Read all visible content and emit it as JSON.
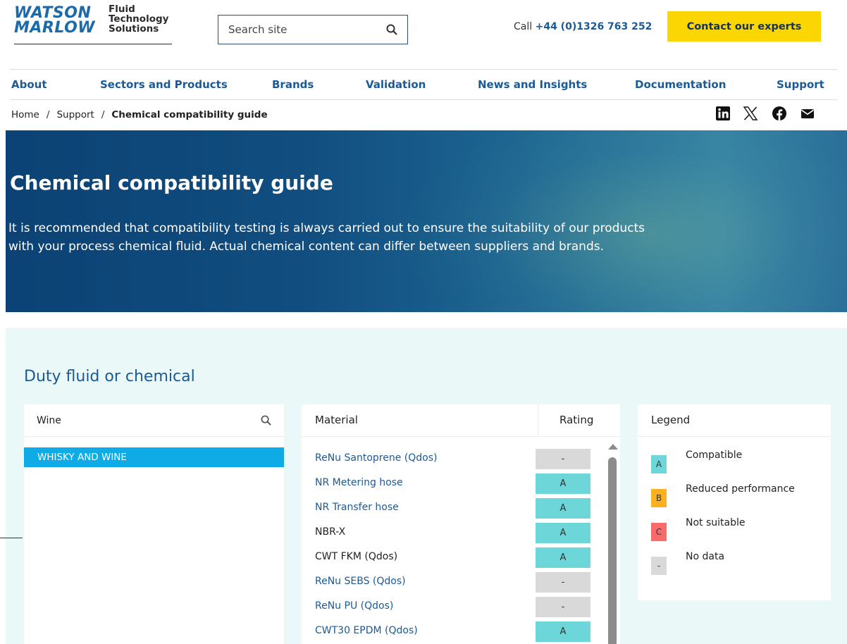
{
  "header": {
    "logo": {
      "line1": "WATSON",
      "line2": "MARLOW",
      "tagline": [
        "Fluid",
        "Technology",
        "Solutions"
      ]
    },
    "search": {
      "placeholder": "Search site",
      "icon": "search-icon"
    },
    "call": {
      "prefix": "Call",
      "number": "+44 (0)1326 763 252"
    },
    "cta_label": "Contact our experts"
  },
  "nav": {
    "items": [
      {
        "label": "About"
      },
      {
        "label": "Sectors and Products"
      },
      {
        "label": "Brands"
      },
      {
        "label": "Validation"
      },
      {
        "label": "News and Insights"
      },
      {
        "label": "Documentation"
      },
      {
        "label": "Support"
      }
    ]
  },
  "breadcrumb": {
    "items": [
      "Home",
      "Support"
    ],
    "separator": "/",
    "current": "Chemical compatibility guide"
  },
  "social": [
    "linkedin-icon",
    "x-icon",
    "facebook-icon",
    "email-icon"
  ],
  "hero": {
    "title": "Chemical compatibility guide",
    "text": "It is recommended that compatibility testing is always carried out to ensure the suitability of our products with your process chemical fluid. Actual chemical content can differ between suppliers and brands."
  },
  "tool": {
    "heading": "Duty fluid or chemical",
    "chemical_search": {
      "value": "Wine",
      "icon": "search-icon"
    },
    "results": [
      "WHISKY AND WINE"
    ],
    "materials": {
      "col_material": "Material",
      "col_rating": "Rating",
      "rows": [
        {
          "name": "ReNu Santoprene (Qdos)",
          "rating": "-",
          "link": true
        },
        {
          "name": "NR Metering hose",
          "rating": "A",
          "link": true
        },
        {
          "name": "NR Transfer hose",
          "rating": "A",
          "link": true
        },
        {
          "name": "NBR-X",
          "rating": "A",
          "link": false
        },
        {
          "name": "CWT FKM (Qdos)",
          "rating": "A",
          "link": false
        },
        {
          "name": "ReNu SEBS (Qdos)",
          "rating": "-",
          "link": true
        },
        {
          "name": "ReNu PU (Qdos)",
          "rating": "-",
          "link": true
        },
        {
          "name": "CWT30 EPDM (Qdos)",
          "rating": "A",
          "link": true
        }
      ]
    },
    "legend": {
      "title": "Legend",
      "items": [
        {
          "code": "A",
          "label": "Compatible"
        },
        {
          "code": "B",
          "label": "Reduced performance"
        },
        {
          "code": "C",
          "label": "Not suitable"
        },
        {
          "code": "-",
          "label": "No data"
        }
      ]
    }
  },
  "colors": {
    "brand_blue": "#1a5a96",
    "cta_yellow": "#fbd603",
    "rating_A": "#6dd6d9",
    "rating_B": "#fbb11d",
    "rating_C": "#fa6a6a",
    "rating_none": "#d9d9d9",
    "selected_result": "#0eabe6",
    "section_bg": "#eaf8f8"
  }
}
